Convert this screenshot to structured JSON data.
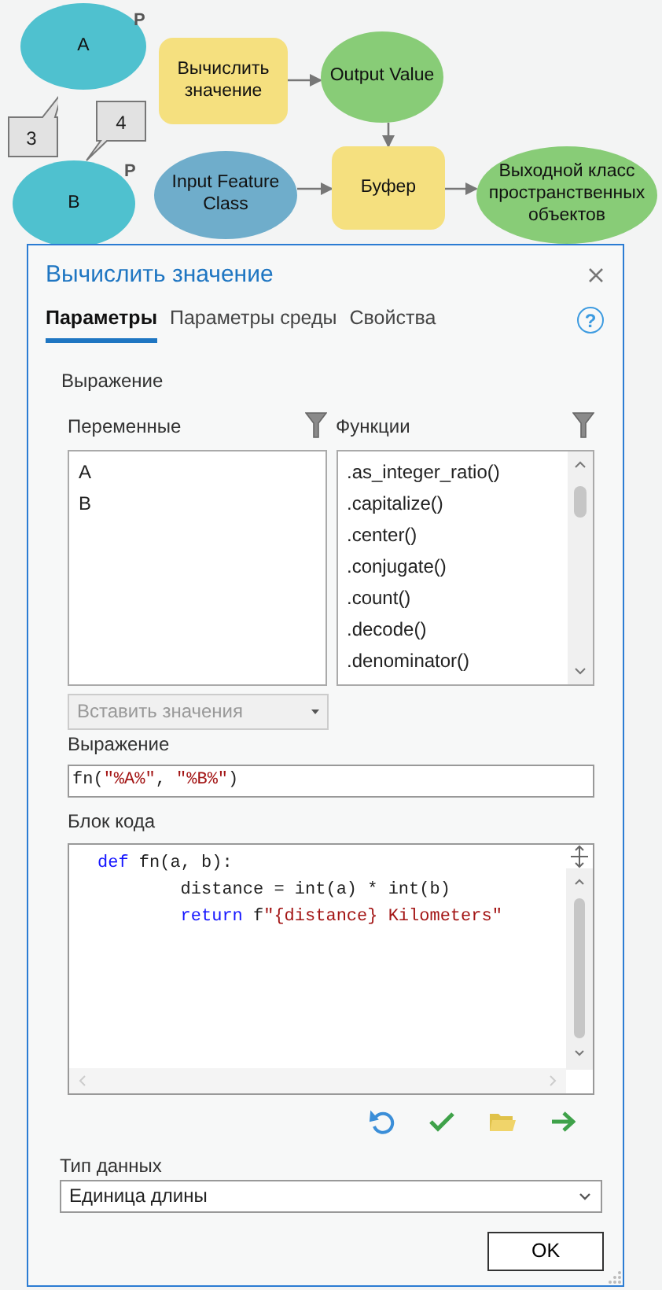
{
  "model": {
    "nodes": [
      {
        "kind": "variable",
        "label": "A",
        "color": "#4fc1cf",
        "tag": "P"
      },
      {
        "kind": "callout",
        "label": "3"
      },
      {
        "kind": "callout",
        "label": "4"
      },
      {
        "kind": "variable",
        "label": "B",
        "color": "#4fc1cf",
        "tag": "P"
      },
      {
        "kind": "tool",
        "label": "Вычислить значение",
        "color": "#f5e07f"
      },
      {
        "kind": "variable",
        "label": "Output Value",
        "color": "#88cc77"
      },
      {
        "kind": "variable",
        "label": "Input Feature Class",
        "color": "#6fadcb"
      },
      {
        "kind": "tool",
        "label": "Буфер",
        "color": "#f5e07f"
      },
      {
        "kind": "variable",
        "label": "Выходной класс пространственных объектов",
        "color": "#88cc77"
      }
    ]
  },
  "dialog": {
    "title": "Вычислить значение",
    "tabs": [
      {
        "label": "Параметры",
        "selected": true
      },
      {
        "label": "Параметры среды",
        "selected": false
      },
      {
        "label": "Свойства",
        "selected": false
      }
    ],
    "help": "?",
    "section_label": "Выражение",
    "variables": {
      "label": "Переменные",
      "items": [
        "A",
        "B"
      ]
    },
    "functions": {
      "label": "Функции",
      "items": [
        ".as_integer_ratio()",
        ".capitalize()",
        ".center()",
        ".conjugate()",
        ".count()",
        ".decode()",
        ".denominator()"
      ]
    },
    "insert_values": {
      "label": "Вставить значения",
      "disabled": true
    },
    "expression": {
      "label": "Выражение",
      "tokens": [
        {
          "text": "fn(",
          "kind": "plain"
        },
        {
          "text": "\"%A%\"",
          "kind": "string"
        },
        {
          "text": ", ",
          "kind": "plain"
        },
        {
          "text": "\"%B%\"",
          "kind": "string"
        },
        {
          "text": ")",
          "kind": "plain"
        }
      ]
    },
    "code_block": {
      "label": "Блок кода",
      "lines": [
        {
          "tokens": [
            {
              "text": "def",
              "kind": "keyword"
            },
            {
              "text": " fn(a, b):",
              "kind": "plain"
            }
          ],
          "children": [
            {
              "tokens": [
                {
                  "text": "distance = int(a) * int(b)",
                  "kind": "plain"
                }
              ]
            },
            {
              "tokens": [
                {
                  "text": "return",
                  "kind": "keyword"
                },
                {
                  "text": " f",
                  "kind": "plain"
                },
                {
                  "text": "\"{distance} Kilometers\"",
                  "kind": "string"
                }
              ]
            }
          ]
        }
      ]
    },
    "data_type": {
      "label": "Тип данных",
      "value": "Единица длины"
    },
    "ok": "OK"
  }
}
